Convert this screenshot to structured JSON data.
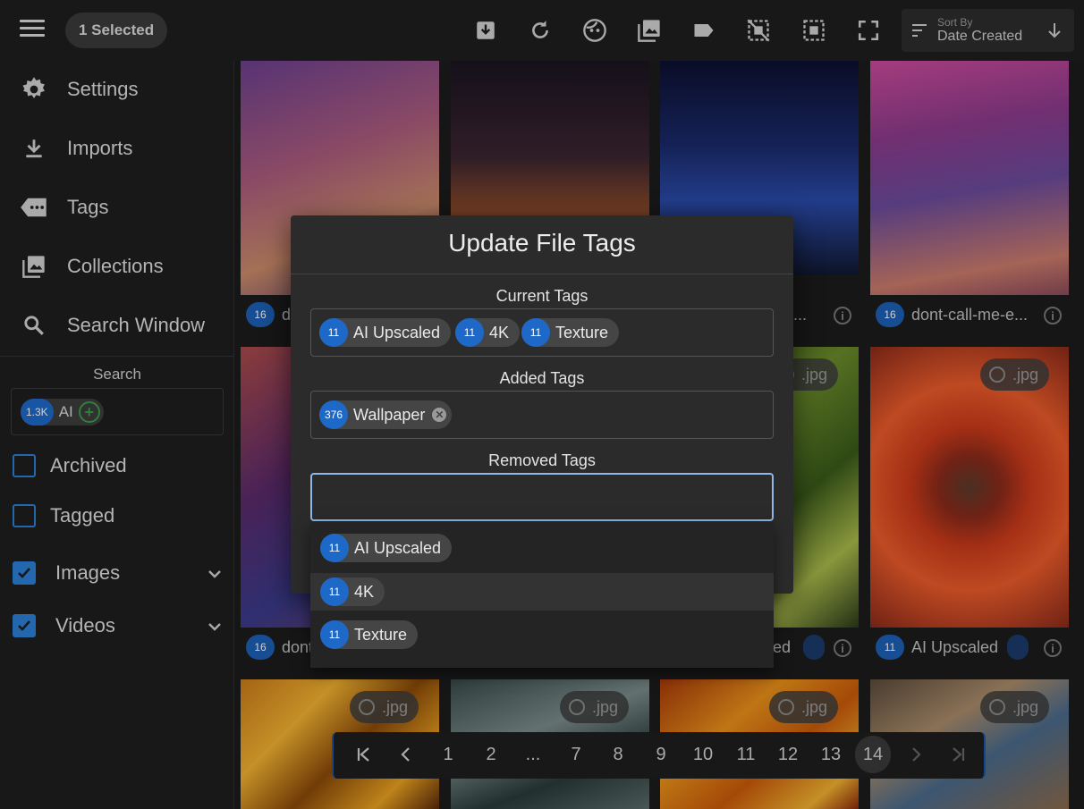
{
  "toolbar": {
    "selected_label": "1 Selected",
    "sort_label": "Sort By",
    "sort_value": "Date Created"
  },
  "sidebar": {
    "items": [
      {
        "label": "Settings",
        "icon": "gear-icon"
      },
      {
        "label": "Imports",
        "icon": "download-icon"
      },
      {
        "label": "Tags",
        "icon": "tag-icon"
      },
      {
        "label": "Collections",
        "icon": "collections-icon"
      },
      {
        "label": "Search Window",
        "icon": "search-icon"
      }
    ],
    "search_label": "Search",
    "search_chip": {
      "count": "1.3K",
      "label": "AI"
    },
    "filters": [
      {
        "label": "Archived",
        "checked": false
      },
      {
        "label": "Tagged",
        "checked": false
      },
      {
        "label": "Images",
        "checked": true
      },
      {
        "label": "Videos",
        "checked": true
      }
    ]
  },
  "grid": {
    "cards": [
      {
        "count": "16",
        "text": "d"
      },
      {
        "count": "",
        "text": "-e..."
      },
      {
        "count": "16",
        "text": "dont-call-me-e..."
      },
      {
        "count": "16",
        "text": "dont"
      },
      {
        "count": "",
        "text": "ed"
      },
      {
        "count": "11",
        "text": "AI Upscaled"
      }
    ],
    "ext_label": ".jpg"
  },
  "pagination": {
    "pages": [
      "1",
      "2",
      "...",
      "7",
      "8",
      "9",
      "10",
      "11",
      "12",
      "13",
      "14"
    ],
    "active": "14"
  },
  "modal": {
    "title": "Update File Tags",
    "current_label": "Current Tags",
    "current_tags": [
      {
        "count": "11",
        "label": "AI Upscaled"
      },
      {
        "count": "11",
        "label": "4K"
      },
      {
        "count": "11",
        "label": "Texture"
      }
    ],
    "added_label": "Added Tags",
    "added_tags": [
      {
        "count": "376",
        "label": "Wallpaper"
      }
    ],
    "removed_label": "Removed Tags",
    "removed_input_value": "",
    "dropdown_options": [
      {
        "count": "11",
        "label": "AI Upscaled"
      },
      {
        "count": "11",
        "label": "4K"
      },
      {
        "count": "11",
        "label": "Texture"
      }
    ]
  },
  "colors": {
    "accent": "#1e68c7",
    "focus_border": "#8fb8e8",
    "checkbox": "#2b7fd6"
  }
}
